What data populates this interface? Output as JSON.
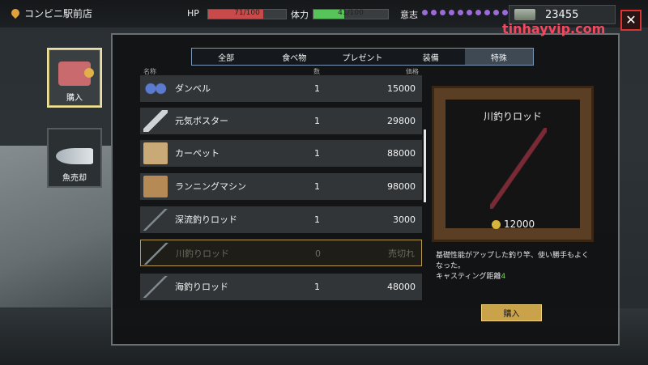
{
  "top": {
    "location": "コンビニ駅前店",
    "hp": {
      "label": "HP",
      "value": "71/100",
      "fill": 0.71,
      "color": "#c94a4a"
    },
    "stamina": {
      "label": "体力",
      "value": "41/100",
      "fill": 0.41,
      "color": "#57c45a"
    },
    "will": {
      "label": "意志",
      "dots": 11,
      "color": "#9b6bd6"
    },
    "money": "23455",
    "close_icon": "close-icon"
  },
  "side": {
    "buy": {
      "label": "購入",
      "icon": "wallet-icon"
    },
    "sell_fish": {
      "label": "魚売却",
      "icon": "fish-icon"
    }
  },
  "tabs": [
    {
      "label": "全部"
    },
    {
      "label": "食べ物"
    },
    {
      "label": "プレゼント"
    },
    {
      "label": "装備"
    },
    {
      "label": "特殊",
      "active": true
    }
  ],
  "columns": {
    "name": "名称",
    "qty": "数",
    "price": "価格"
  },
  "items": [
    {
      "name": "ダンベル",
      "qty": "1",
      "price": "15000",
      "icon": "dumbbell-icon"
    },
    {
      "name": "元気ボスター",
      "qty": "1",
      "price": "29800",
      "icon": "booster-icon"
    },
    {
      "name": "カーペット",
      "qty": "1",
      "price": "88000",
      "icon": "carpet-icon"
    },
    {
      "name": "ランニングマシン",
      "qty": "1",
      "price": "98000",
      "icon": "treadmill-icon"
    },
    {
      "name": "深流釣りロッド",
      "qty": "1",
      "price": "3000",
      "icon": "rod-icon"
    },
    {
      "name": "川釣りロッド",
      "qty": "0",
      "price": "売切れ",
      "icon": "rod-icon",
      "sold": true
    },
    {
      "name": "海釣りロッド",
      "qty": "1",
      "price": "48000",
      "icon": "rod-icon"
    }
  ],
  "detail": {
    "title": "川釣りロッド",
    "price": "12000",
    "desc_1": "基礎性能がアップした釣り竿、使い勝手もよくなった。",
    "desc_2": "キャスティング距離",
    "desc_value": "4",
    "buy_label": "購入"
  },
  "watermark": "tinhayvip.com"
}
